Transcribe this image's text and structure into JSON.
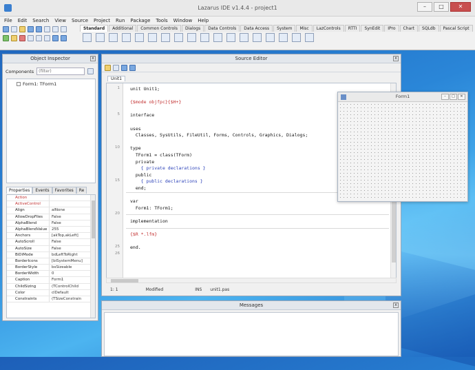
{
  "window": {
    "title": "Lazarus IDE v1.4.4 - project1"
  },
  "window_buttons": {
    "minimize": "–",
    "maximize": "□",
    "close": "✕"
  },
  "menu": [
    "File",
    "Edit",
    "Search",
    "View",
    "Source",
    "Project",
    "Run",
    "Package",
    "Tools",
    "Window",
    "Help"
  ],
  "palette_tabs": [
    "Standard",
    "Additional",
    "Common Controls",
    "Dialogs",
    "Data Controls",
    "Data Access",
    "System",
    "Misc",
    "LazControls",
    "RTTI",
    "SynEdit",
    "IPro",
    "Chart",
    "SQLdb",
    "Pascal Script"
  ],
  "object_inspector": {
    "title": "Object Inspector",
    "components_label": "Components",
    "filter_placeholder": "(filter)",
    "tree_node": "Form1: TForm1",
    "tabs": [
      "Properties",
      "Events",
      "Favorites",
      "Re"
    ],
    "properties": [
      {
        "name": "Action",
        "value": "",
        "red": true
      },
      {
        "name": "ActiveControl",
        "value": "",
        "red": true
      },
      {
        "name": "Align",
        "value": "alNone",
        "red": false
      },
      {
        "name": "AllowDropFiles",
        "value": "False",
        "red": false
      },
      {
        "name": "AlphaBlend",
        "value": "False",
        "red": false
      },
      {
        "name": "AlphaBlendValue",
        "value": "255",
        "red": false
      },
      {
        "name": "Anchors",
        "value": "[akTop,akLeft]",
        "red": false
      },
      {
        "name": "AutoScroll",
        "value": "False",
        "red": false
      },
      {
        "name": "AutoSize",
        "value": "False",
        "red": false
      },
      {
        "name": "BiDiMode",
        "value": "bdLeftToRight",
        "red": false
      },
      {
        "name": "BorderIcons",
        "value": "[biSystemMenu]",
        "red": false
      },
      {
        "name": "BorderStyle",
        "value": "bsSizeable",
        "red": false
      },
      {
        "name": "BorderWidth",
        "value": "0",
        "red": false
      },
      {
        "name": "Caption",
        "value": "Form1",
        "red": false
      },
      {
        "name": "ChildSizing",
        "value": "(TControlChild",
        "red": false
      },
      {
        "name": "Color",
        "value": "clDefault",
        "red": false
      },
      {
        "name": "Constraints",
        "value": "(TSizeConstrain",
        "red": false
      }
    ]
  },
  "source_editor": {
    "title": "Source Editor",
    "tab": "Unit1",
    "lines": [
      {
        "n": "1",
        "text": "unit Unit1;",
        "cls": "kw"
      },
      {
        "n": "",
        "text": "",
        "cls": "kw"
      },
      {
        "n": "",
        "text": "{$mode objfpc}{$H+}",
        "cls": "dir"
      },
      {
        "n": "",
        "text": "",
        "cls": "kw"
      },
      {
        "n": "5",
        "text": "interface",
        "cls": "kw"
      },
      {
        "n": "",
        "text": "",
        "cls": "kw"
      },
      {
        "n": "",
        "text": "uses",
        "cls": "kw"
      },
      {
        "n": "",
        "text": "  Classes, SysUtils, FileUtil, Forms, Controls, Graphics, Dialogs;",
        "cls": "kw"
      },
      {
        "n": "",
        "text": "",
        "cls": "kw"
      },
      {
        "n": "10",
        "text": "type",
        "cls": "kw"
      },
      {
        "n": "",
        "text": "  TForm1 = class(TForm)",
        "cls": "kw"
      },
      {
        "n": "",
        "text": "  private",
        "cls": "kw"
      },
      {
        "n": "",
        "text": "    { private declarations }",
        "cls": "cm"
      },
      {
        "n": "",
        "text": "  public",
        "cls": "kw"
      },
      {
        "n": "15",
        "text": "    { public declarations }",
        "cls": "cm"
      },
      {
        "n": "",
        "text": "  end;",
        "cls": "kw"
      },
      {
        "n": "",
        "text": "",
        "cls": "kw"
      },
      {
        "n": "",
        "text": "var",
        "cls": "kw"
      },
      {
        "n": "",
        "text": "  Form1: TForm1;",
        "cls": "kw"
      },
      {
        "n": "20",
        "text": "",
        "cls": "kw"
      },
      {
        "n": "",
        "text": "implementation",
        "cls": "kw"
      },
      {
        "n": "",
        "text": "",
        "cls": "kw"
      },
      {
        "n": "",
        "text": "{$R *.lfm}",
        "cls": "dir"
      },
      {
        "n": "",
        "text": "",
        "cls": "kw"
      },
      {
        "n": "25",
        "text": "end.",
        "cls": "kw"
      },
      {
        "n": "26",
        "text": "",
        "cls": "kw"
      }
    ],
    "status": {
      "pos": "1: 1",
      "modified": "Modified",
      "mode": "INS",
      "file": "unit1.pas"
    }
  },
  "form_designer": {
    "caption": "Form1"
  },
  "messages": {
    "title": "Messages"
  }
}
